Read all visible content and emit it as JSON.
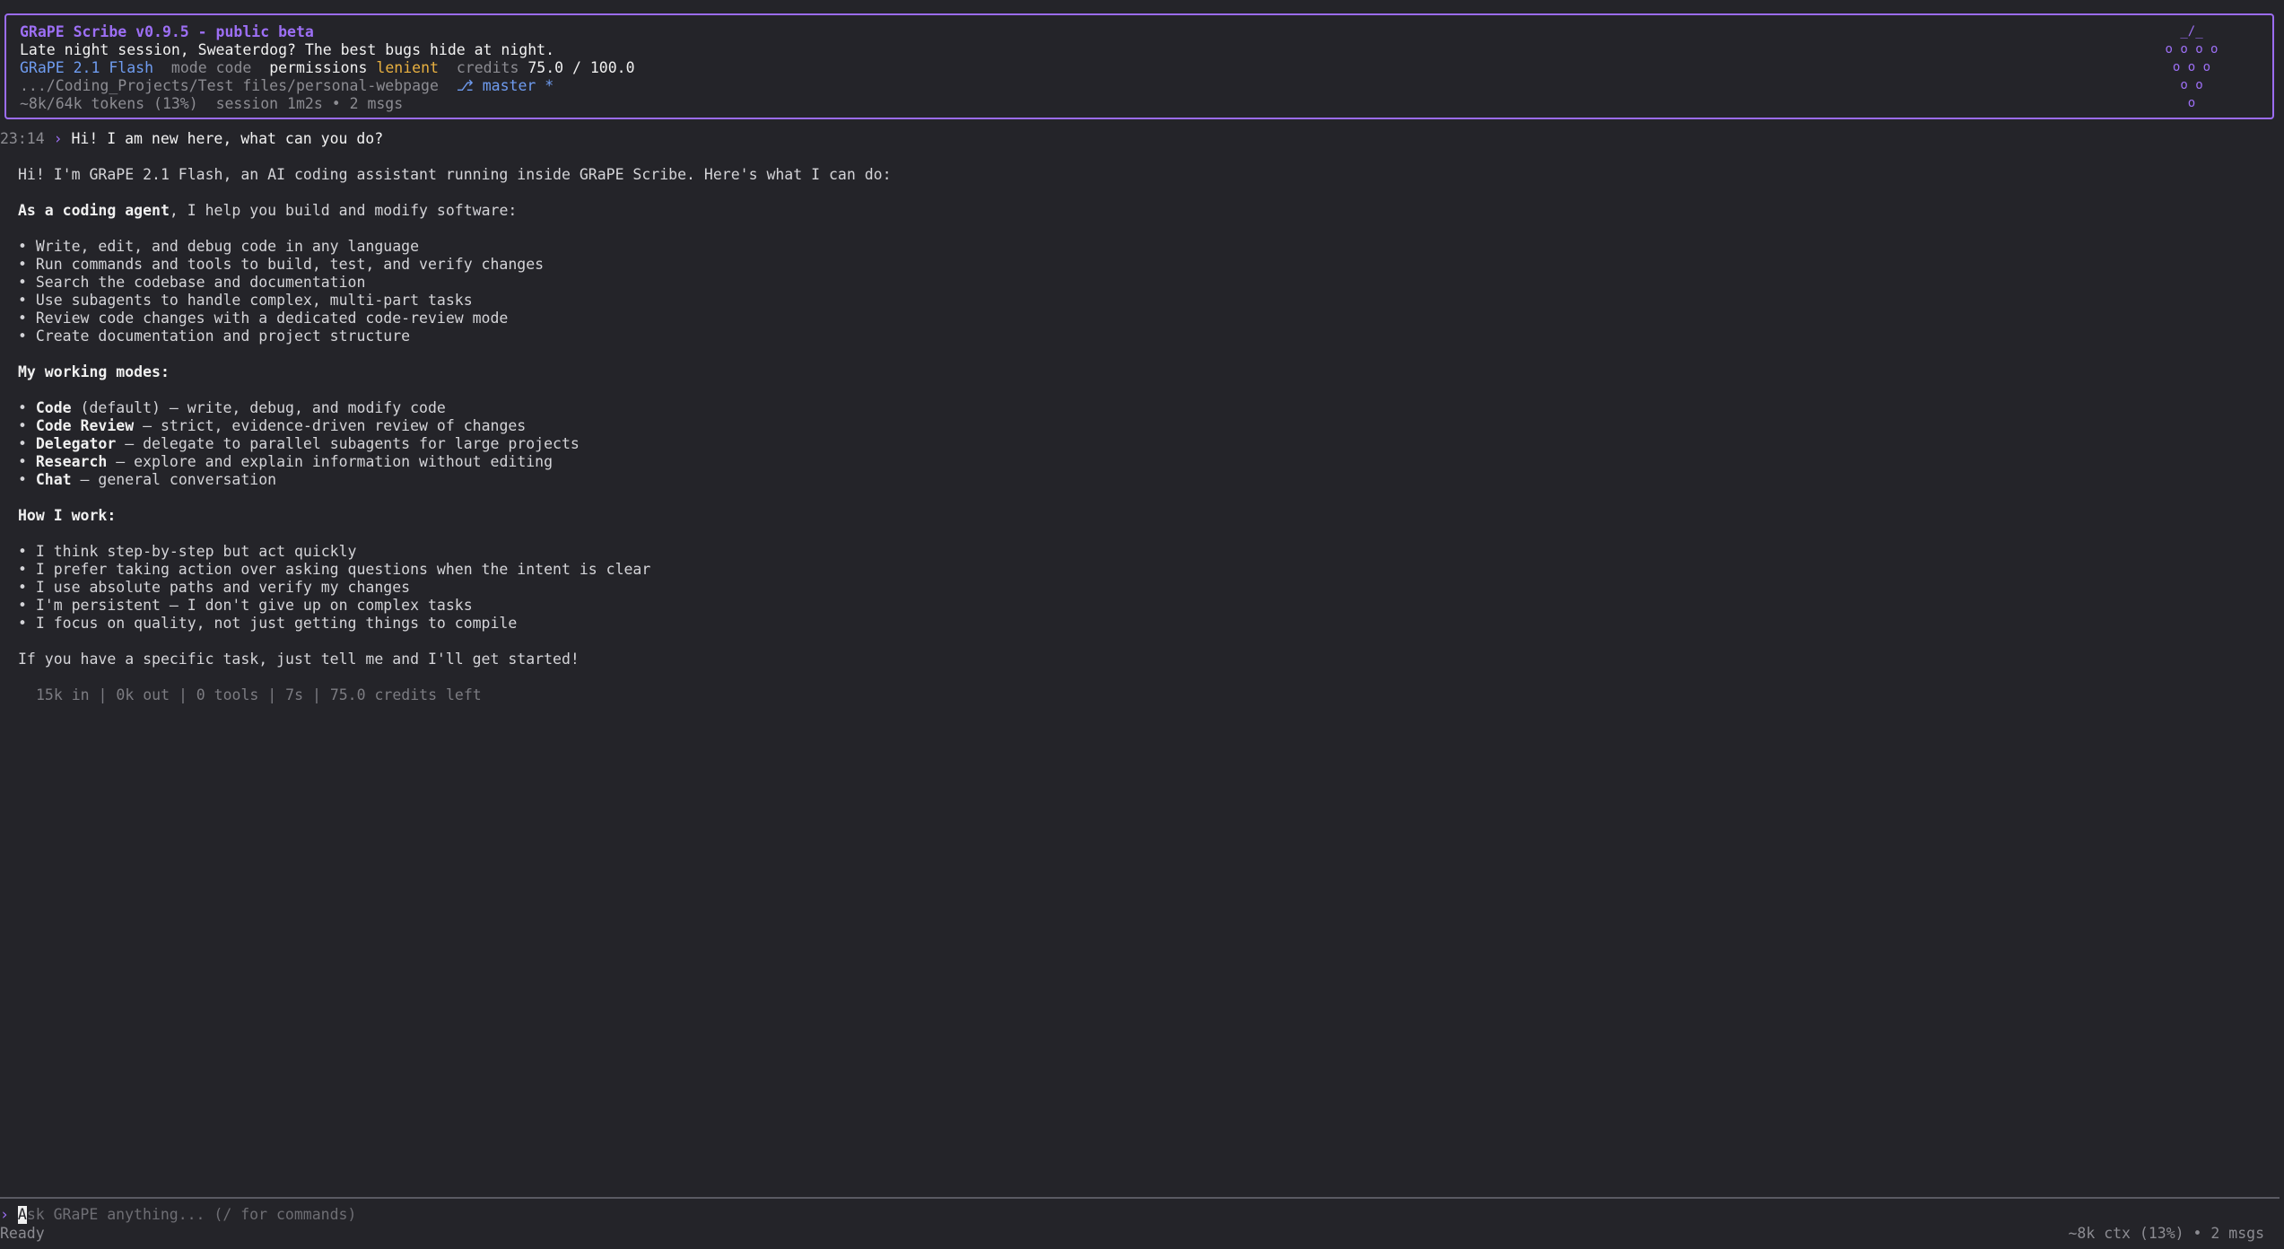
{
  "header": {
    "title": "GRaPE Scribe v0.9.5 - public beta",
    "greeting": "Late night session, Sweaterdog? The best bugs hide at night.",
    "model": "GRaPE 2.1 Flash",
    "mode_label": "mode",
    "mode_value": "code",
    "permissions_label": "permissions",
    "permissions_value": "lenient",
    "credits_label": "credits",
    "credits_value": "75.0 / 100.0",
    "path": ".../Coding_Projects/Test files/personal-webpage",
    "branch": "⎇ master *",
    "tokens": "~8k/64k tokens (13%)",
    "session": "session 1m2s • 2 msgs",
    "logo_lines": [
      "_/_",
      "o o o o",
      "o o o",
      "o o",
      "o"
    ]
  },
  "conversation": {
    "timestamp": "23:14",
    "prompt_chevron": "›",
    "user_message": "Hi! I am new here, what can you do?",
    "intro": "Hi! I'm GRaPE 2.1 Flash, an AI coding assistant running inside GRaPE Scribe. Here's what I can do:",
    "agent_heading_bold": "As a coding agent",
    "agent_heading_rest": ", I help you build and modify software:",
    "abilities": [
      "• Write, edit, and debug code in any language",
      "• Run commands and tools to build, test, and verify changes",
      "• Search the codebase and documentation",
      "• Use subagents to handle complex, multi-part tasks",
      "• Review code changes with a dedicated code-review mode",
      "• Create documentation and project structure"
    ],
    "modes_heading": "My working modes:",
    "modes": [
      {
        "name": "Code",
        "desc": " (default) — write, debug, and modify code"
      },
      {
        "name": "Code Review",
        "desc": " — strict, evidence-driven review of changes"
      },
      {
        "name": "Delegator",
        "desc": " — delegate to parallel subagents for large projects"
      },
      {
        "name": "Research",
        "desc": " — explore and explain information without editing"
      },
      {
        "name": "Chat",
        "desc": " — general conversation"
      }
    ],
    "work_heading": "How I work:",
    "work_items": [
      "• I think step-by-step but act quickly",
      "• I prefer taking action over asking questions when the intent is clear",
      "• I use absolute paths and verify my changes",
      "• I'm persistent — I don't give up on complex tasks",
      "• I focus on quality, not just getting things to compile"
    ],
    "closing": "If you have a specific task, just tell me and I'll get started!",
    "stats": "15k in | 0k out | 0 tools | 7s | 75.0 credits left"
  },
  "input": {
    "chevron": "›",
    "cursor_char": "A",
    "placeholder_rest": "sk GRaPE anything... (/ for commands)"
  },
  "status": {
    "left": "Ready",
    "right": "~8k ctx (13%) • 2 msgs"
  },
  "colors": {
    "background": "#242429",
    "accent": "#9d6ff5",
    "model": "#6f9cf0",
    "warning": "#e8b040"
  }
}
